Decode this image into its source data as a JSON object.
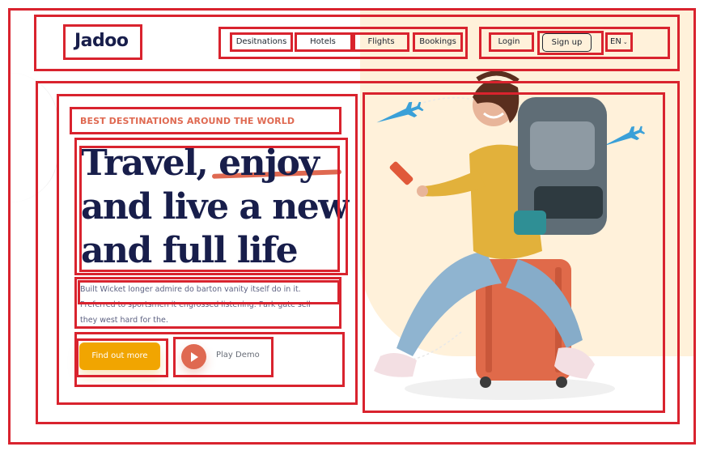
{
  "brand": {
    "logo_text": "Jadoo"
  },
  "nav": {
    "items": [
      "Desitnations",
      "Hotels",
      "Flights",
      "Bookings"
    ],
    "login_label": "Login",
    "signup_label": "Sign up",
    "language_label": "EN"
  },
  "hero": {
    "eyebrow": "BEST DESTINATIONS AROUND THE WORLD",
    "headline": "Travel, enjoy and live a new and full life",
    "subtext": "Built Wicket longer admire do barton vanity itself do in it. Preferred to sportsmen it engrossed listening. Park gate sell they west hard for the.",
    "cta_label": "Find out more",
    "demo_label": "Play Demo"
  },
  "icons": [
    "play-icon",
    "chevron-down-icon",
    "airplane-icon"
  ],
  "colors": {
    "accent": "#df6951",
    "cta": "#f1a501",
    "heading": "#181e4b",
    "body_text": "#5e6282",
    "blob": "#fff1da",
    "annotation": "#d9232e"
  }
}
